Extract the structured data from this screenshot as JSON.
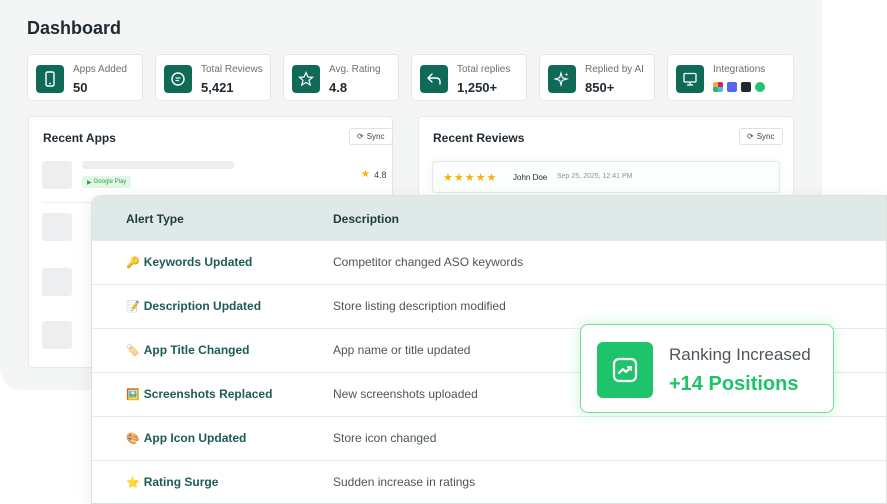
{
  "dashboard": {
    "title": "Dashboard",
    "stats": [
      {
        "label": "Apps Added",
        "value": "50",
        "icon": "phone-icon"
      },
      {
        "label": "Total Reviews",
        "value": "5,421",
        "icon": "chat-icon"
      },
      {
        "label": "Avg. Rating",
        "value": "4.8",
        "icon": "star-icon"
      },
      {
        "label": "Total replies",
        "value": "1,250+",
        "icon": "reply-icon"
      },
      {
        "label": "Replied by AI",
        "value": "850+",
        "icon": "sparkle-icon"
      },
      {
        "label": "Integrations",
        "icon": "monitor-icon"
      }
    ],
    "recent_apps": {
      "title": "Recent Apps",
      "sync": "Sync",
      "badge": "Google Play",
      "rating": "4.8"
    },
    "recent_reviews": {
      "title": "Recent Reviews",
      "sync": "Sync",
      "review": {
        "stars": "★★★★★",
        "name": "John Doe",
        "date": "Sep 25, 2025, 12:41 PM"
      }
    }
  },
  "alerts": {
    "headers": {
      "type": "Alert Type",
      "description": "Description"
    },
    "rows": [
      {
        "emoji": "🔑",
        "type": "Keywords Updated",
        "description": "Competitor changed ASO keywords"
      },
      {
        "emoji": "📝",
        "type": "Description Updated",
        "description": "Store listing description modified"
      },
      {
        "emoji": "🏷️",
        "type": "App Title Changed",
        "description": "App name or title updated"
      },
      {
        "emoji": "🖼️",
        "type": "Screenshots Replaced",
        "description": "New screenshots uploaded"
      },
      {
        "emoji": "🎨",
        "type": "App Icon Updated",
        "description": "Store icon changed"
      },
      {
        "emoji": "⭐",
        "type": "Rating Surge",
        "description": "Sudden increase in ratings"
      }
    ]
  },
  "ranking": {
    "label": "Ranking Increased",
    "value": "+14 Positions"
  },
  "colors": {
    "brand": "#0f6b57",
    "accent_green": "#1dc46a",
    "table_header": "#dfe9e7"
  }
}
